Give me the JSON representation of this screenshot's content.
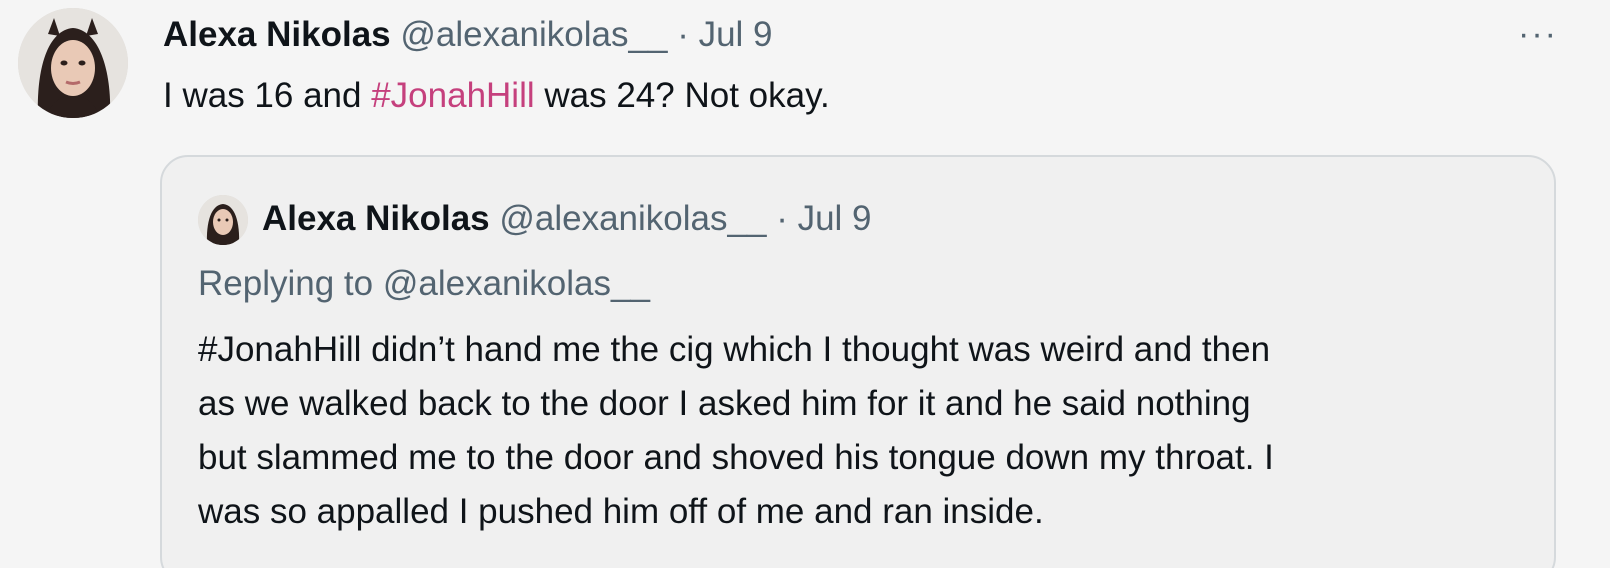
{
  "tweet": {
    "author_name": "Alexa Nikolas",
    "handle": "@alexanikolas__",
    "separator": "·",
    "date": "Jul 9",
    "more_label": "···",
    "text_before": "I was 16 and ",
    "hashtag": "#JonahHill",
    "text_after": " was 24? Not okay."
  },
  "quote": {
    "author_name": "Alexa Nikolas",
    "handle": "@alexanikolas__",
    "separator": "·",
    "date": "Jul 9",
    "replying_to": "Replying to @alexanikolas__",
    "lines": [
      "#JonahHill didn’t hand me the cig which I thought was weird and then",
      "as we walked back to the door I asked him for it and he said nothing",
      "but slammed me to the door and shoved his tongue down my throat. I",
      "was so appalled I pushed him off of me and ran inside."
    ]
  },
  "colors": {
    "hashtag": "#c5407d",
    "secondary_text": "#536471",
    "background": "#f5f5f5",
    "quote_border": "#d5d9dc"
  },
  "icons": {
    "more": "more-horizontal-icon"
  }
}
